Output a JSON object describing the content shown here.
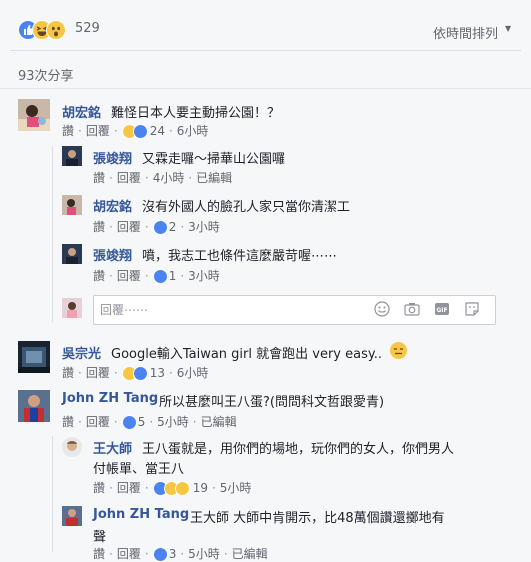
{
  "header": {
    "reaction_count": "529",
    "sort_label": "依時間排列",
    "shares_label": "93次分享",
    "reaction_icons": [
      "like-icon",
      "haha-icon",
      "wow-icon"
    ]
  },
  "comments": [
    {
      "name": "胡宏銘",
      "text": "難怪日本人要主動掃公園！？",
      "like": "讚",
      "reply": "回覆",
      "reaction_count": "24",
      "time": "6小時",
      "replies": [
        {
          "name": "張竣翔",
          "text": "又霖走囉～掃華山公園囉",
          "like": "讚",
          "reply": "回覆",
          "time": "4小時",
          "edited": "已編輯"
        },
        {
          "name": "胡宏銘",
          "text": "沒有外國人的臉孔人家只當你清潔工",
          "like": "讚",
          "reply": "回覆",
          "reaction_count": "2",
          "time": "3小時"
        },
        {
          "name": "張竣翔",
          "text": "噴，我志工也條件這麼嚴苛喔⋯⋯",
          "like": "讚",
          "reply": "回覆",
          "reaction_count": "1",
          "time": "3小時"
        }
      ],
      "reply_placeholder": "回覆⋯⋯"
    },
    {
      "name": "吳宗光",
      "text": "Google輸入Taiwan girl 就會跑出 very easy..",
      "like": "讚",
      "reply": "回覆",
      "reaction_count": "13",
      "time": "6小時"
    },
    {
      "name": "John ZH Tang",
      "text": "所以甚麼叫王八蛋?(問問科文哲跟愛青)",
      "like": "讚",
      "reply": "回覆",
      "reaction_count": "5",
      "time": "5小時",
      "edited": "已編輯",
      "replies": [
        {
          "name": "王大師",
          "text_line1": "王八蛋就是，用你們的場地，玩你們的女人，你們男人",
          "text_line2": "付帳單、當王八",
          "like": "讚",
          "reply": "回覆",
          "reaction_count": "19",
          "time": "5小時"
        },
        {
          "name": "John ZH Tang",
          "text_line1": "王大師 大師中肯開示，比48萬個讚還擲地有",
          "text_line2": "聲",
          "like": "讚",
          "reply": "回覆",
          "reaction_count": "3",
          "time": "5小時",
          "edited": "已編輯"
        }
      ]
    }
  ],
  "colors": {
    "link": "#365899",
    "meta": "#616770",
    "like_blue": "#4b83f1",
    "emoji_yellow": "#f7c744"
  }
}
